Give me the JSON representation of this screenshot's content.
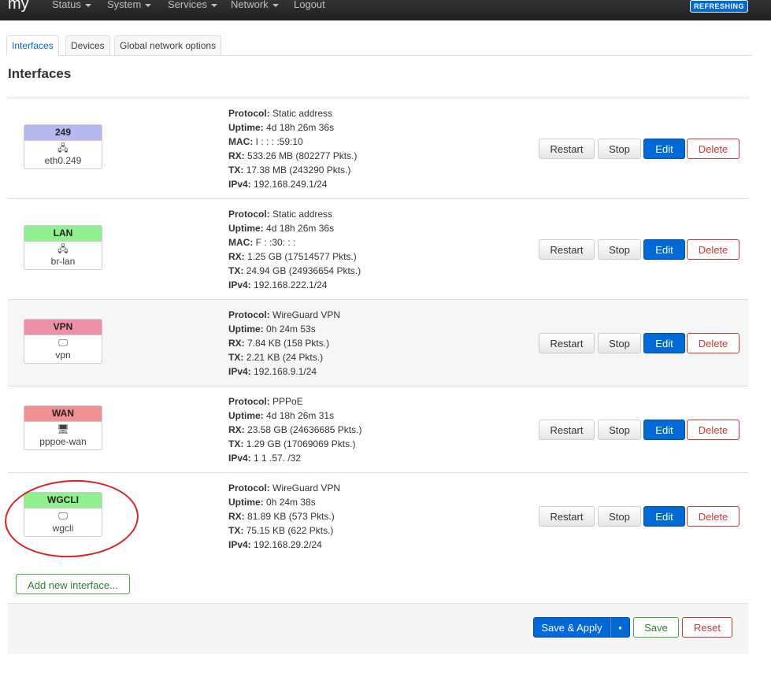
{
  "nav": {
    "brand": "my",
    "menus": [
      "Status",
      "System",
      "Services",
      "Network",
      "Logout"
    ],
    "status_badge": "REFRESHING"
  },
  "tabs": [
    "Interfaces",
    "Devices",
    "Global network options"
  ],
  "page_title": "Interfaces",
  "labels": {
    "protocol": "Protocol:",
    "uptime": "Uptime:",
    "mac": "MAC:",
    "rx": "RX:",
    "tx": "TX:",
    "ipv4": "IPv4:"
  },
  "interfaces": [
    {
      "name": "249",
      "device": "eth0.249",
      "color": "#b8b8f0",
      "protocol": "Static address",
      "uptime": "4d 18h 26m 36s",
      "mac": "I  :   :   :  :59:10",
      "rx": "533.26 MB (802277 Pkts.)",
      "tx": "17.38 MB (243290 Pkts.)",
      "ipv4": "192.168.249.1/24"
    },
    {
      "name": "LAN",
      "device": "br-lan",
      "color": "#90f090",
      "protocol": "Static address",
      "uptime": "4d 18h 26m 36s",
      "mac": "F  :  :30:  :  :  ",
      "rx": "1.25 GB (17514577 Pkts.)",
      "tx": "24.94 GB (24936654 Pkts.)",
      "ipv4": "192.168.222.1/24"
    },
    {
      "name": "VPN",
      "device": "vpn",
      "color": "#f08fa8",
      "protocol": "WireGuard VPN",
      "uptime": "0h 24m 53s",
      "rx": "7.84 KB (158 Pkts.)",
      "tx": "2.21 KB (24 Pkts.)",
      "ipv4": "192.168.9.1/24"
    },
    {
      "name": "WAN",
      "device": "pppoe-wan",
      "color": "#f09090",
      "protocol": "PPPoE",
      "uptime": "4d 18h 26m 31s",
      "rx": "23.58 GB (24636685 Pkts.)",
      "tx": "1.29 GB (17069069 Pkts.)",
      "ipv4": "1    1  .57.  /32"
    },
    {
      "name": "WGCLI",
      "device": "wgcli",
      "color": "#90f090",
      "protocol": "WireGuard VPN",
      "uptime": "0h 24m 38s",
      "rx": "81.89 KB (573 Pkts.)",
      "tx": "75.15 KB (622 Pkts.)",
      "ipv4": "192.168.29.2/24"
    }
  ],
  "row_buttons": {
    "restart": "Restart",
    "stop": "Stop",
    "edit": "Edit",
    "delete": "Delete"
  },
  "add_button": "Add new interface...",
  "footer": {
    "save_apply": "Save & Apply",
    "save": "Save",
    "reset": "Reset"
  }
}
